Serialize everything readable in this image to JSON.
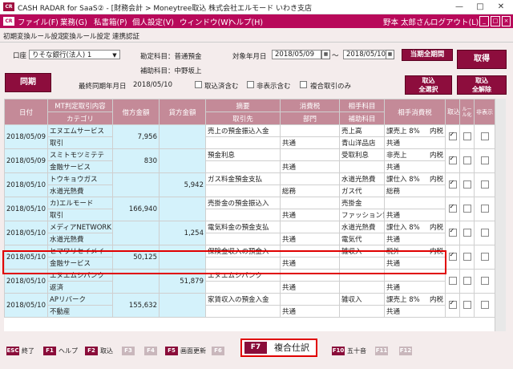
{
  "window": {
    "title": "CASH RADAR for SaaS② - [財務会計 > Moneytree取込 株式会社エルモード いわき支店",
    "app_icon": "CR"
  },
  "menu": {
    "items": [
      "ファイル(F)",
      "業務(G)",
      "私書箱(P)",
      "個人設定(V)",
      "ウィンドウ(W)",
      "ヘルプ(H)"
    ],
    "user": "野本 太郎さん",
    "logout": "ログアウト(L)"
  },
  "tabs": [
    "初期変換ルール設定",
    "変換ルール設定",
    "連携認証"
  ],
  "filters": {
    "account_label": "口座",
    "account_value": "りそな銀行(法人) 1",
    "kanjo_label": "勘定科目：普通預金",
    "hojo_label": "補助科目：中野坂上",
    "target_label": "対象年月日",
    "date_from": "2018/05/09",
    "tilde": "〜",
    "date_to": "2018/05/10",
    "last_sync_label": "最終同期年月日",
    "last_sync_value": "2018/05/10",
    "cb_imported": "取込済含む",
    "cb_hidden": "非表示含む",
    "cb_multi": "複合取引のみ"
  },
  "buttons": {
    "all_period": "当期全期間",
    "fetch": "取得",
    "sync": "同期",
    "select_all_line1": "取込",
    "select_all_line2": "全選択",
    "deselect_all_line1": "取込",
    "deselect_all_line2": "全解除"
  },
  "columns": {
    "date": "日付",
    "mt_content_1": "MT判定取引内容",
    "mt_content_2": "カテゴリ",
    "debit": "借方金額",
    "credit": "貸方金額",
    "summary_1": "摘要",
    "summary_2": "取引先",
    "tax_1": "消費税",
    "tax_2": "部門",
    "partner_1": "相手科目",
    "partner_2": "補助科目",
    "partner_tax": "相手消費税",
    "import": "取込",
    "rule": "ルール化",
    "hide": "非表示"
  },
  "rows": [
    {
      "date": "2018/05/09",
      "mt1": "エヌエムサービス",
      "mt2": "取引",
      "debit": "7,956",
      "credit": "",
      "sum1": "売上の預金振込入金",
      "sum2": "",
      "tax1": "",
      "tax2": "共通",
      "p1": "売上高",
      "p2": "青山洋品店",
      "ptax1": "課売上 8%",
      "ptax_mode": "内税",
      "ptax2": "共通",
      "import": true,
      "rule": false,
      "hide": false
    },
    {
      "date": "2018/05/09",
      "mt1": "スミトモツミテテ",
      "mt2": "金融サービス",
      "debit": "830",
      "credit": "",
      "sum1": "預金利息",
      "sum2": "",
      "tax1": "",
      "tax2": "共通",
      "p1": "受取利息",
      "p2": "",
      "ptax1": "非売上",
      "ptax_mode": "内税",
      "ptax2": "共通",
      "import": true,
      "rule": false,
      "hide": false
    },
    {
      "date": "2018/05/10",
      "mt1": "トウキョウガス",
      "mt2": "水道光熱費",
      "debit": "",
      "credit": "5,942",
      "sum1": "ガス料金預金支払",
      "sum2": "",
      "tax1": "",
      "tax2": "総務",
      "p1": "水道光熱費",
      "p2": "ガス代",
      "ptax1": "課仕入 8%",
      "ptax_mode": "内税",
      "ptax2": "総務",
      "import": true,
      "rule": false,
      "hide": false
    },
    {
      "date": "2018/05/10",
      "mt1": "カ)エルモード",
      "mt2": "取引",
      "debit": "166,940",
      "credit": "",
      "sum1": "売掛金の預金振込入",
      "sum2": "",
      "tax1": "",
      "tax2": "共通",
      "p1": "売掛金",
      "p2": "ファッション青",
      "ptax1": "",
      "ptax_mode": "",
      "ptax2": "共通",
      "import": true,
      "rule": false,
      "hide": false
    },
    {
      "date": "2018/05/10",
      "mt1": "メディアNETWORK",
      "mt2": "水道光熱費",
      "debit": "",
      "credit": "1,254",
      "sum1": "電気料金の預金支払",
      "sum2": "",
      "tax1": "",
      "tax2": "共通",
      "p1": "水道光熱費",
      "p2": "電気代",
      "ptax1": "課仕入 8%",
      "ptax_mode": "内税",
      "ptax2": "共通",
      "import": true,
      "rule": false,
      "hide": false
    },
    {
      "date": "2018/05/10",
      "mt1": "ヒマワリセイメイ",
      "mt2": "金融サービス",
      "debit": "50,125",
      "credit": "",
      "sum1": "保険金収入の預金入",
      "sum2": "",
      "tax1": "",
      "tax2": "共通",
      "p1": "雑収入",
      "p2": "",
      "ptax1": "税外",
      "ptax_mode": "内税",
      "ptax2": "共通",
      "import": true,
      "rule": false,
      "hide": false
    },
    {
      "date": "2018/05/10",
      "mt1": "エヌエムシバンク",
      "mt2": "返済",
      "debit": "",
      "credit": "51,879",
      "sum1": "エヌエムシバンク",
      "sum2": "",
      "tax1": "",
      "tax2": "共通",
      "p1": "",
      "p2": "",
      "ptax1": "",
      "ptax_mode": "",
      "ptax2": "共通",
      "import": false,
      "rule": false,
      "hide": false
    },
    {
      "date": "2018/05/10",
      "mt1": "APリバーク",
      "mt2": "不動産",
      "debit": "155,632",
      "credit": "",
      "sum1": "家賃収入の預金入金",
      "sum2": "",
      "tax1": "",
      "tax2": "共通",
      "p1": "雑収入",
      "p2": "",
      "ptax1": "課売上 8%",
      "ptax_mode": "内税",
      "ptax2": "共通",
      "import": true,
      "rule": false,
      "hide": false
    }
  ],
  "fkeys": [
    {
      "key": "ESC",
      "label": "終了",
      "enabled": true
    },
    {
      "key": "F1",
      "label": "ヘルプ",
      "enabled": true
    },
    {
      "key": "F2",
      "label": "取込",
      "enabled": true
    },
    {
      "key": "F3",
      "label": "",
      "enabled": false
    },
    {
      "key": "F4",
      "label": "",
      "enabled": false
    },
    {
      "key": "F5",
      "label": "画面更新",
      "enabled": true
    },
    {
      "key": "F6",
      "label": "",
      "enabled": false
    },
    {
      "key": "F7",
      "label": "複合仕訳",
      "enabled": true
    },
    {
      "key": "F10",
      "label": "五十音",
      "enabled": true
    },
    {
      "key": "F11",
      "label": "",
      "enabled": false
    },
    {
      "key": "F12",
      "label": "",
      "enabled": false
    }
  ],
  "colors": {
    "brand": "#b8095a",
    "button": "#8d0d3d",
    "header": "#c48a98",
    "cell_highlight": "#d4f2fb",
    "selection": "#e00000"
  }
}
